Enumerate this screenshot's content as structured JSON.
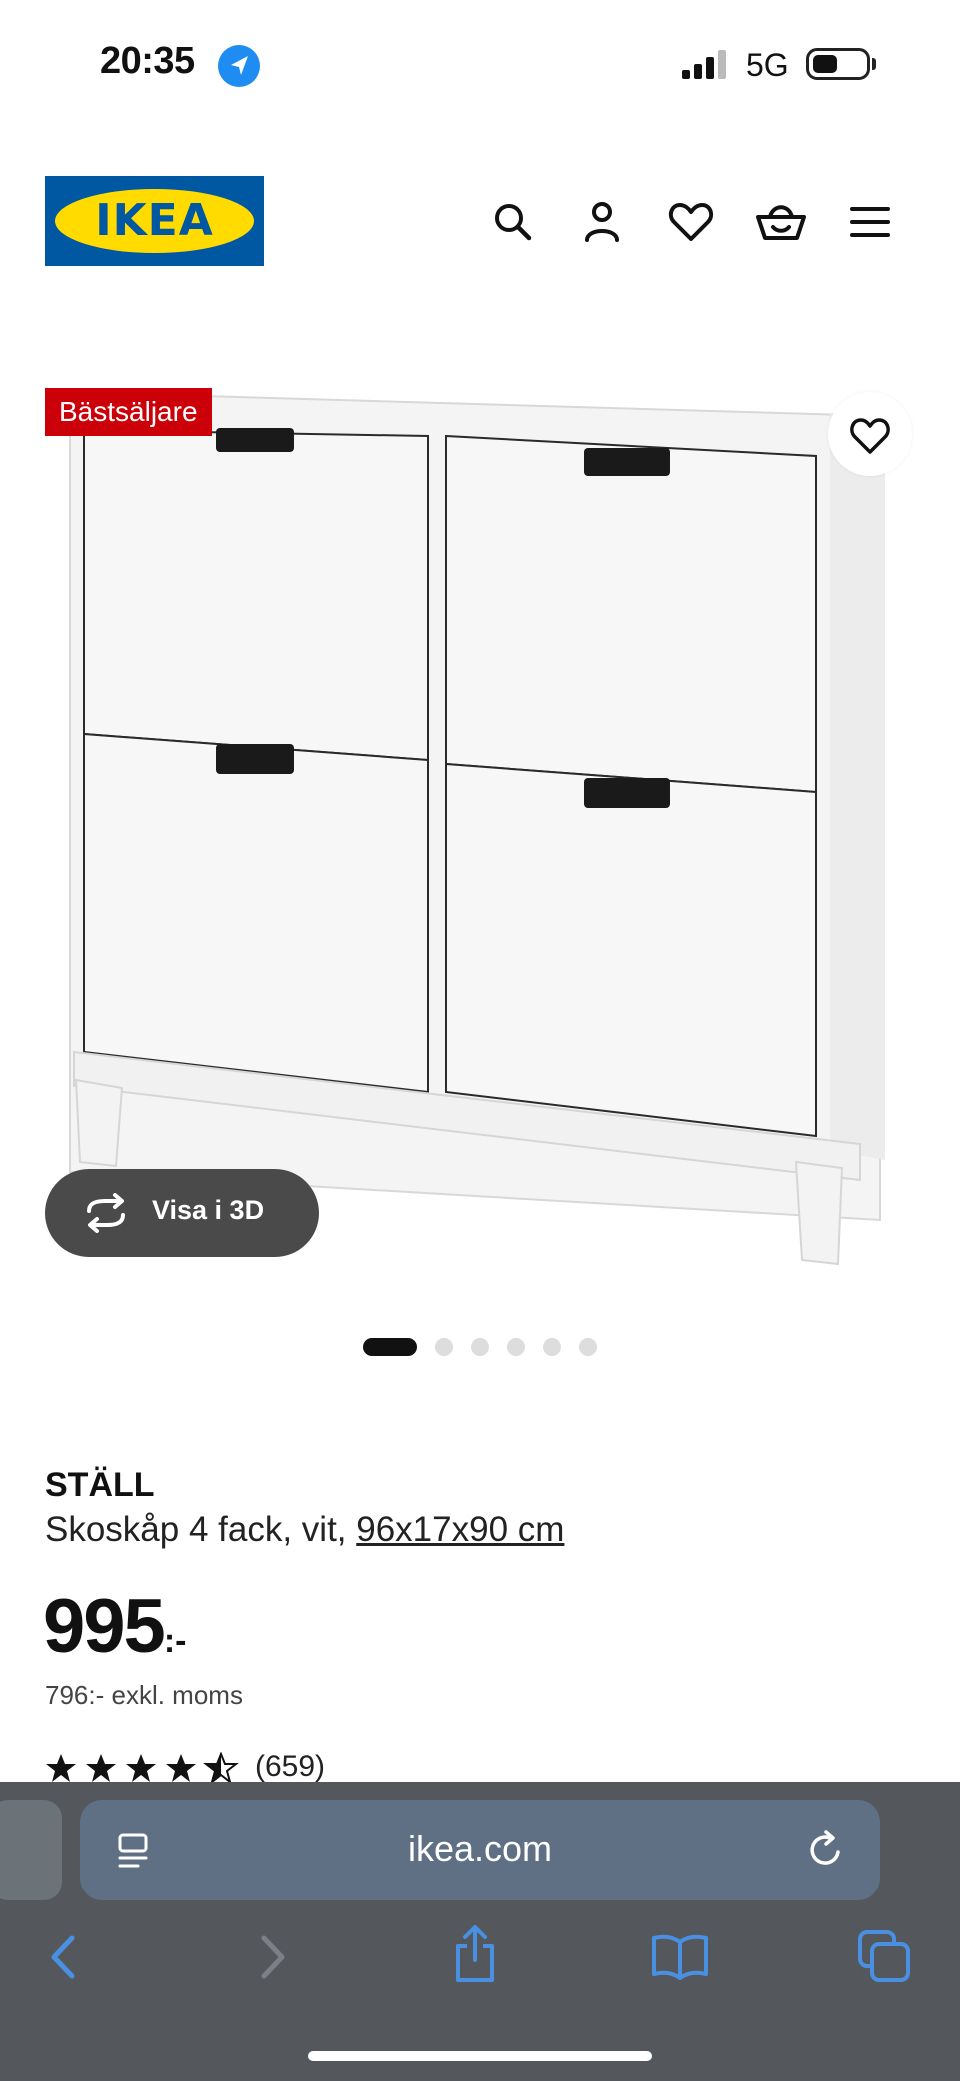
{
  "status_bar": {
    "time": "20:35",
    "network": "5G"
  },
  "header": {
    "logo_text": "IKEA"
  },
  "product": {
    "badge": "Bästsäljare",
    "view_3d_label": "Visa i 3D",
    "gallery_count": 6,
    "gallery_active_index": 0,
    "name": "STÄLL",
    "description": "Skoskåp 4 fack, vit, ",
    "size_link": "96x17x90 cm",
    "price": "995",
    "price_suffix": ":-",
    "price_excl_vat": "796:- exkl. moms",
    "rating": 4.5,
    "review_count": "(659)"
  },
  "browser": {
    "url": "ikea.com"
  },
  "colors": {
    "ikea_blue": "#0058a3",
    "ikea_yellow": "#ffdb00",
    "badge_red": "#cc0008",
    "safari_blue": "#4a90e2"
  }
}
